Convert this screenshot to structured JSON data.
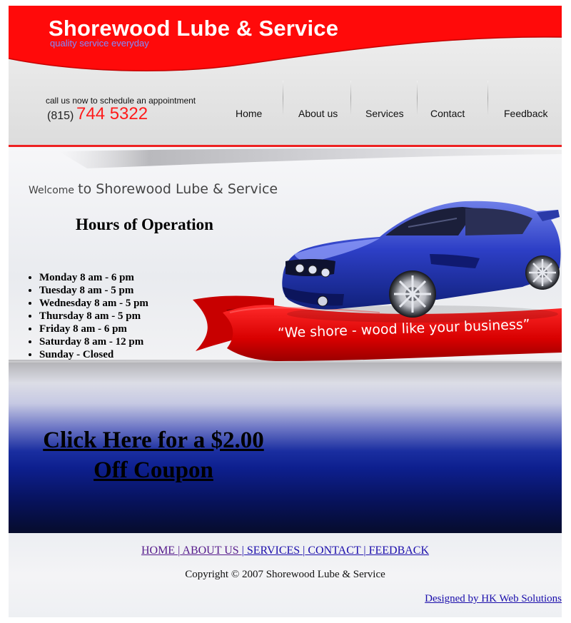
{
  "header": {
    "title": "Shorewood Lube & Service",
    "tagline": "quality service everyday",
    "call_text": "call us now to schedule an appointment",
    "area_code": "(815)",
    "phone": "744 5322"
  },
  "nav": {
    "home": "Home",
    "about": "About us",
    "services": "Services",
    "contact": "Contact",
    "feedback": "Feedback"
  },
  "banner": {
    "welcome_small": "Welcome",
    "welcome_large": "to Shorewood Lube & Service",
    "hours_title": "Hours of Operation",
    "hours": [
      "Monday 8 am - 6 pm",
      "Tuesday 8 am - 5 pm",
      "Wednesday 8 am - 5 pm",
      "Thursday 8 am - 5 pm",
      "Friday 8 am - 6 pm",
      "Saturday 8 am - 12 pm",
      "Sunday - Closed"
    ],
    "slogan": "“We shore - wood like your business”"
  },
  "coupon": {
    "line1": "Click Here for a $2.00",
    "line2": "Off Coupon"
  },
  "footer": {
    "links": {
      "home": "HOME ",
      "about": " ABOUT US ",
      "services": " SERVICES ",
      "contact": " CONTACT ",
      "feedback": " FEEDBACK"
    },
    "separator": "|",
    "copyright": "Copyright © 2007 Shorewood Lube & Service",
    "designer": "Designed by HK Web Solutions"
  },
  "colors": {
    "brand_red": "#ff0000",
    "accent_blue": "#2a3bbf",
    "link_blue": "#1a0dab",
    "link_visited": "#551a8b"
  }
}
